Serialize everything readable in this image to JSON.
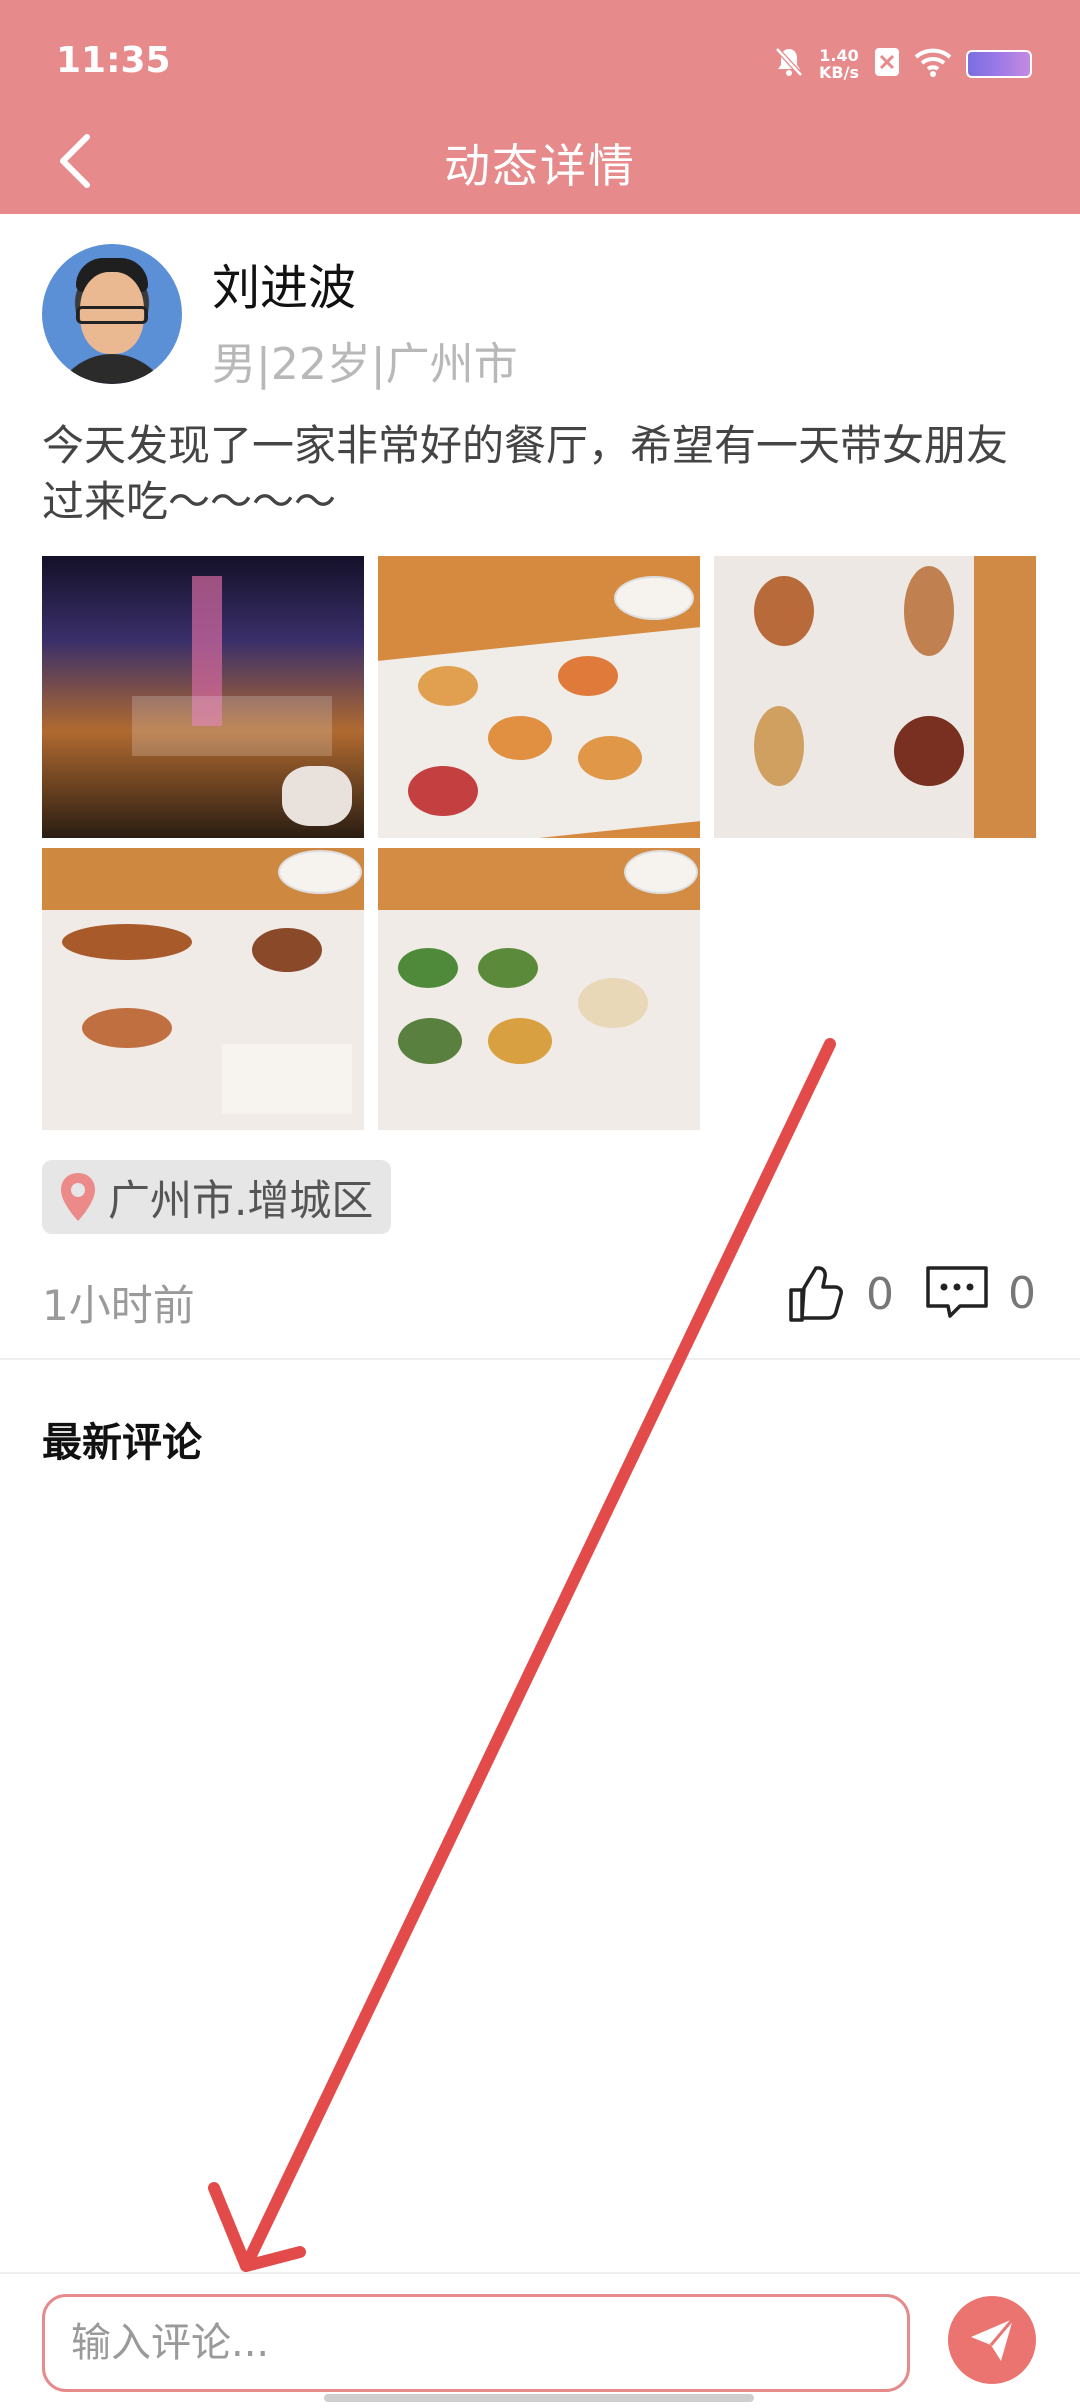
{
  "status_bar": {
    "time": "11:35",
    "net_speed_value": "1.40",
    "net_speed_unit": "KB/s"
  },
  "header": {
    "title": "动态详情",
    "background_color": "#e78a8b"
  },
  "post": {
    "author_name": "刘进波",
    "author_meta": "男|22岁|广州市",
    "text": "今天发现了一家非常好的餐厅，希望有一天带女朋友过来吃～～～～",
    "photos_count": 5,
    "location": "广州市.增城区",
    "time_ago": "1小时前",
    "like_count": "0",
    "comment_count": "0"
  },
  "comments_section": {
    "title": "最新评论"
  },
  "comment_box": {
    "placeholder": "输入评论...",
    "accent_color": "#e78a8b"
  },
  "icons": {
    "back": "chevron-left-icon",
    "location": "map-pin-icon",
    "like": "thumbs-up-icon",
    "comment": "chat-bubble-icon",
    "send": "paper-plane-icon"
  }
}
